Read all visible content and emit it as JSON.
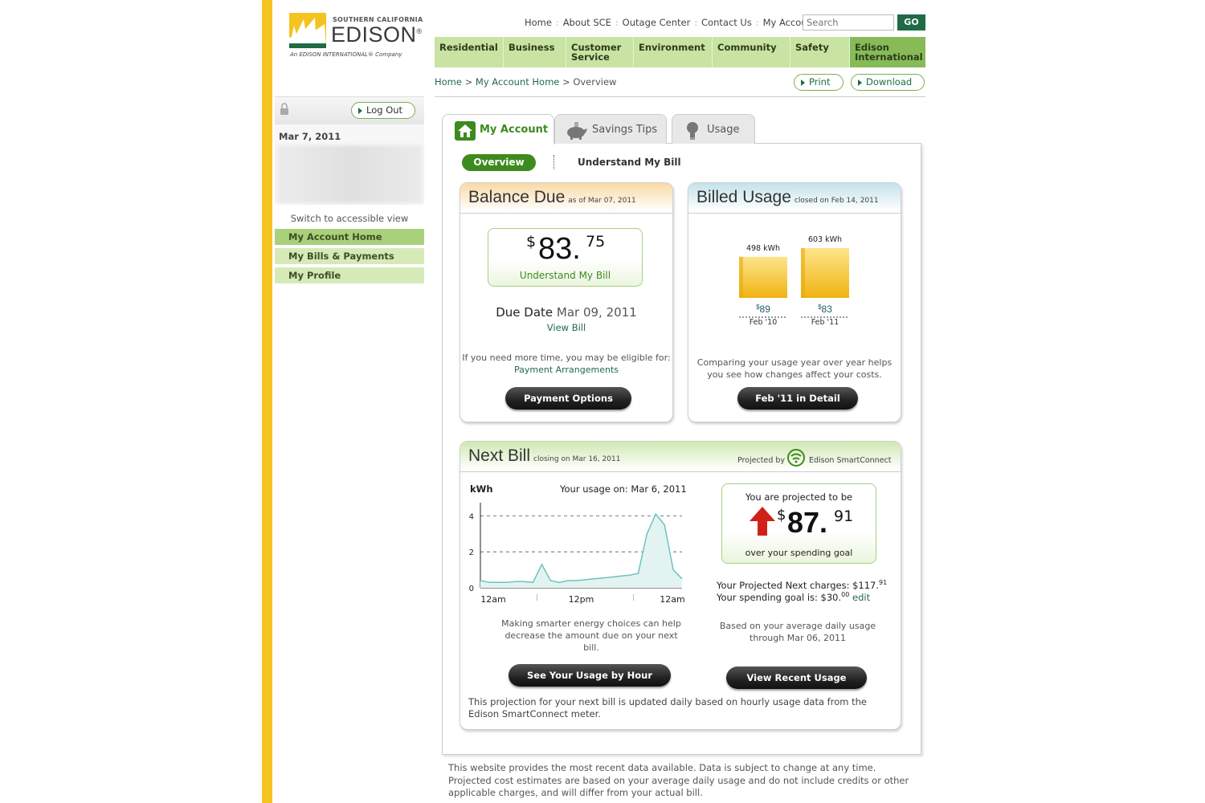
{
  "logo": {
    "top": "SOUTHERN CALIFORNIA",
    "main": "EDISON",
    "mark": "®",
    "sub": "An EDISON INTERNATIONAL® Company"
  },
  "toplinks": [
    "Home",
    "About SCE",
    "Outage Center",
    "Contact Us",
    "My Account"
  ],
  "search": {
    "placeholder": "Search",
    "go": "GO"
  },
  "nav": [
    {
      "line1": "Residential",
      "line2": ""
    },
    {
      "line1": "Business",
      "line2": ""
    },
    {
      "line1": "Customer",
      "line2": "Service"
    },
    {
      "line1": "Environment",
      "line2": ""
    },
    {
      "line1": "Community",
      "line2": ""
    },
    {
      "line1": "Safety",
      "line2": ""
    },
    {
      "line1": "Edison",
      "line2": "International"
    }
  ],
  "breadcrumb": {
    "home": "Home",
    "sep": ">",
    "account": "My Account Home",
    "current": "Overview"
  },
  "actions": {
    "print": "Print",
    "download": "Download"
  },
  "sidebar": {
    "logout": "Log Out",
    "date": "Mar 7, 2011",
    "accessible": "Switch to accessible view",
    "items": [
      "My Account Home",
      "My Bills & Payments",
      "My Profile"
    ]
  },
  "tabs": [
    "My Account",
    "Savings Tips",
    "Usage"
  ],
  "subtabs": {
    "overview": "Overview",
    "understand": "Understand My Bill"
  },
  "balance": {
    "title": "Balance Due",
    "sub": "as of Mar 07, 2011",
    "currency": "$",
    "dollars": "83.",
    "cents": "75",
    "understand": "Understand My Bill",
    "due_label": "Due Date",
    "due_date": "Mar 09, 2011",
    "view_bill": "View Bill",
    "more_time": "If you need more time, you may be eligible for:",
    "arrangements": "Payment Arrangements",
    "button": "Payment Options"
  },
  "billed": {
    "title": "Billed Usage",
    "sub": "closed on Feb 14, 2011",
    "bars": [
      {
        "kwh": "498 kWh",
        "value": 498,
        "cost_sym": "$",
        "cost": "89",
        "period": "Feb '10"
      },
      {
        "kwh": "603 kWh",
        "value": 603,
        "cost_sym": "$",
        "cost": "83",
        "period": "Feb '11"
      }
    ],
    "note": "Comparing your usage year over year helps you see how changes affect your costs.",
    "button": "Feb '11 in Detail"
  },
  "nextbill": {
    "title": "Next Bill",
    "sub": "closing on Mar 16, 2011",
    "projected_by": "Projected by",
    "brand": "Edison SmartConnect",
    "chart_unit": "kWh",
    "chart_title": "Your usage on: Mar 6, 2011",
    "xticks": [
      "12am",
      "12pm",
      "12am"
    ],
    "yticks": [
      "4",
      "2",
      "0"
    ],
    "making": "Making smarter energy choices can help decrease the amount due on your next bill.",
    "usage_button": "See Your Usage by Hour",
    "proj_top": "You are projected to be",
    "proj_currency": "$",
    "proj_dollars": "87.",
    "proj_cents": "91",
    "proj_bottom": "over your spending goal",
    "charges_label": "Your Projected Next charges: $117.",
    "charges_cents": "91",
    "goal_label": "Your spending goal is: $30.",
    "goal_cents": "00",
    "edit": "edit",
    "based": "Based on your average daily usage through Mar 06, 2011",
    "recent_button": "View Recent Usage",
    "footer": "This projection for your next bill is updated daily based on hourly usage data from the Edison SmartConnect meter."
  },
  "disclaimer": "This website provides the most recent data available. Data is subject to change at any time. Projected cost estimates are based on your average daily usage and do not include credits or other applicable charges, and will differ from your actual bill.",
  "chart_data": {
    "type": "area",
    "title": "Your usage on: Mar 6, 2011",
    "ylabel": "kWh",
    "xlabel": "",
    "xticks": [
      "12am",
      "12pm",
      "12am"
    ],
    "yticks": [
      0,
      2,
      4
    ],
    "ylim": [
      0,
      5
    ],
    "grid": "dashed at 2 and 4",
    "series": [
      {
        "x": [
          0,
          1,
          2,
          3,
          4,
          5,
          6,
          7,
          8,
          9,
          10,
          11,
          12,
          13,
          14,
          15,
          16,
          17,
          18,
          19,
          20,
          21,
          22,
          23
        ],
        "values": [
          0.4,
          0.3,
          0.3,
          0.3,
          0.35,
          0.35,
          0.3,
          1.3,
          0.4,
          0.3,
          0.4,
          0.4,
          0.45,
          0.5,
          0.55,
          0.6,
          0.65,
          0.7,
          0.8,
          3.0,
          4.1,
          3.5,
          1.0,
          0.5
        ]
      }
    ],
    "color": "#6cc3c0"
  }
}
